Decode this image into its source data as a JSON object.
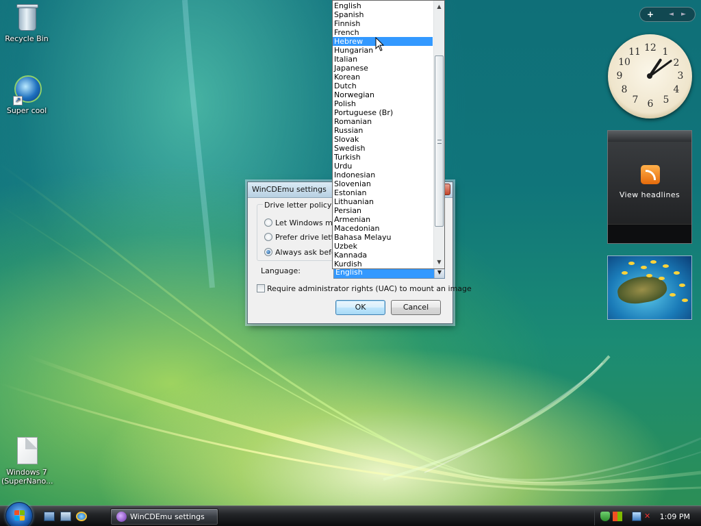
{
  "desktop": {
    "icons": [
      {
        "label": "Recycle Bin"
      },
      {
        "label": "Super cool"
      },
      {
        "label": "Windows 7 (SuperNano..."
      }
    ]
  },
  "sidebar": {
    "controls": {
      "add": "+",
      "prev": "◄",
      "next": "►"
    },
    "clock": {
      "numbers": [
        "12",
        "1",
        "2",
        "3",
        "4",
        "5",
        "6",
        "7",
        "8",
        "9",
        "10",
        "11"
      ]
    },
    "feed": {
      "label": "View headlines"
    }
  },
  "dialog": {
    "title": "WinCDEmu settings",
    "group_label": "Drive letter policy",
    "radios": [
      {
        "label": "Let Windows mana",
        "selected": false
      },
      {
        "label": "Prefer drive letter",
        "selected": false
      },
      {
        "label": "Always ask before",
        "selected": true
      }
    ],
    "language_label": "Language:",
    "language_value": "English",
    "uac_checkbox_label": "Require administrator rights (UAC) to mount an image",
    "uac_checked": false,
    "ok_label": "OK",
    "cancel_label": "Cancel"
  },
  "dropdown": {
    "highlighted": "Hebrew",
    "options": [
      "English",
      "Spanish",
      "Finnish",
      "French",
      "Hebrew",
      "Hungarian",
      "Italian",
      "Japanese",
      "Korean",
      "Dutch",
      "Norwegian",
      "Polish",
      "Portuguese (Br)",
      "Romanian",
      "Russian",
      "Slovak",
      "Swedish",
      "Turkish",
      "Urdu",
      "Indonesian",
      "Slovenian",
      "Estonian",
      "Lithuanian",
      "Persian",
      "Armenian",
      "Macedonian",
      "Bahasa Melayu",
      "Uzbek",
      "Kannada",
      "Kurdish"
    ]
  },
  "taskbar": {
    "task_title": "WinCDEmu settings",
    "time": "1:09 PM"
  },
  "colors": {
    "selection": "#3399ff",
    "taskbar": "#0b0c0d"
  }
}
